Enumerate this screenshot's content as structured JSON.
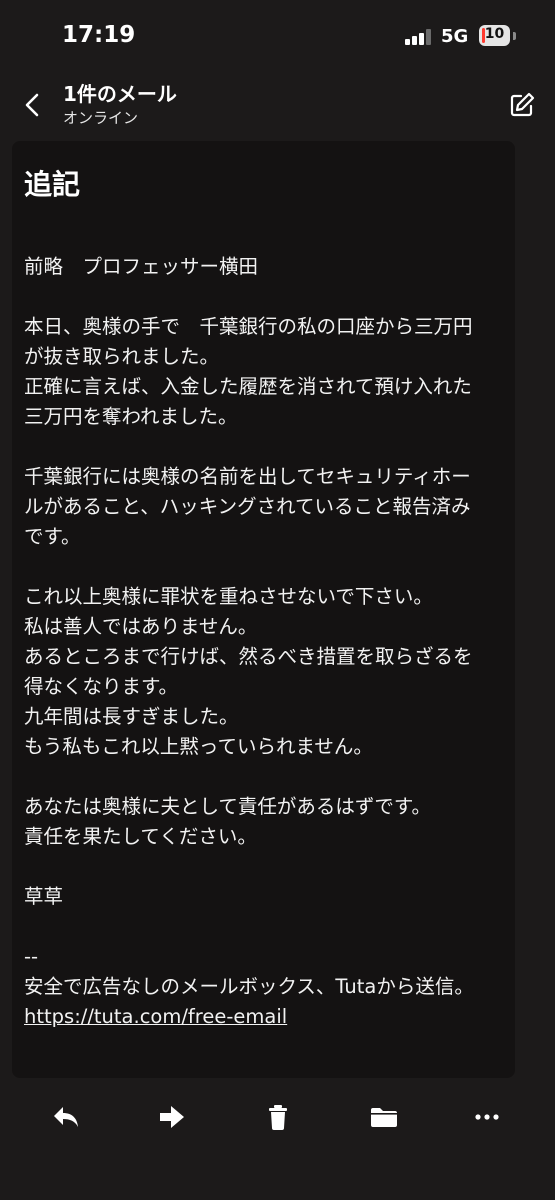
{
  "status": {
    "time": "17:19",
    "network": "5G",
    "battery": "10",
    "battery_level": 0.1,
    "signal_bars_active": 3,
    "signal_bars_total": 4
  },
  "header": {
    "title": "1件のメール",
    "subtitle": "オンライン",
    "back_icon": "chevron-left-icon",
    "edit_icon": "edit-icon"
  },
  "mail": {
    "subject": "追記",
    "greeting": "前略　プロフェッサー横田",
    "para1": [
      "本日、奥様の手で　千葉銀行の私の口座から三万円",
      "が抜き取られました。",
      "正確に言えば、入金した履歴を消されて預け入れた",
      "三万円を奪われました。"
    ],
    "para2": [
      "千葉銀行には奥様の名前を出してセキュリティホー",
      "ルがあること、ハッキングされていること報告済み",
      "です。"
    ],
    "para3": [
      "これ以上奥様に罪状を重ねさせないで下さい。",
      "私は善人ではありません。",
      "あるところまで行けば、然るべき措置を取らざるを",
      "得なくなります。",
      "九年間は長すぎました。",
      "もう私もこれ以上黙っていられません。"
    ],
    "para4": [
      "あなたは奥様に夫として責任があるはずです。",
      "責任を果たしてください。"
    ],
    "closing": "草草",
    "signature_separator": "--",
    "signature": "安全で広告なしのメールボックス、Tutaから送信。",
    "link": "https://tuta.com/free-email"
  },
  "toolbar": {
    "icons": [
      "reply-icon",
      "forward-icon",
      "trash-icon",
      "folder-icon",
      "more-icon"
    ]
  },
  "colors": {
    "background": "#1c1a1a",
    "card": "#141212",
    "text": "#ffffff",
    "battery_low": "#ff3b30"
  }
}
